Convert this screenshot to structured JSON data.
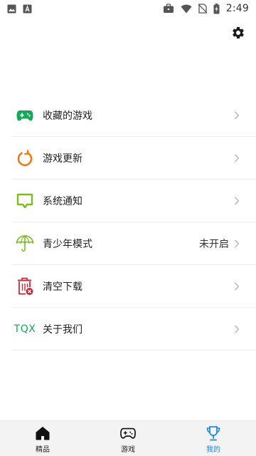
{
  "status_bar": {
    "time": "2:49",
    "left_icons": [
      "image-icon",
      "text-a-icon"
    ],
    "right_icons": [
      "briefcase-icon",
      "wifi-icon",
      "no-sim-icon",
      "battery-charging-icon"
    ]
  },
  "header": {
    "settings_icon": "gear-icon"
  },
  "menu": {
    "items": [
      {
        "label": "收藏的游戏",
        "icon": "gamepad-icon",
        "value": ""
      },
      {
        "label": "游戏更新",
        "icon": "refresh-icon",
        "value": ""
      },
      {
        "label": "系统通知",
        "icon": "notification-icon",
        "value": ""
      },
      {
        "label": "青少年模式",
        "icon": "umbrella-icon",
        "value": "未开启"
      },
      {
        "label": "清空下载",
        "icon": "trash-icon",
        "value": ""
      },
      {
        "label": "关于我们",
        "icon": "tqx-logo",
        "logo_text": "TQX",
        "value": ""
      }
    ]
  },
  "tab_bar": {
    "tabs": [
      {
        "label": "精品",
        "icon": "home-icon",
        "active": false
      },
      {
        "label": "游戏",
        "icon": "gamepad-outline-icon",
        "active": false
      },
      {
        "label": "我的",
        "icon": "trophy-icon",
        "active": true
      }
    ]
  },
  "colors": {
    "green": "#14a85a",
    "orange": "#f07a12",
    "lime": "#7dbb1f",
    "crimson": "#c62839",
    "accent_blue": "#1e88e5"
  }
}
